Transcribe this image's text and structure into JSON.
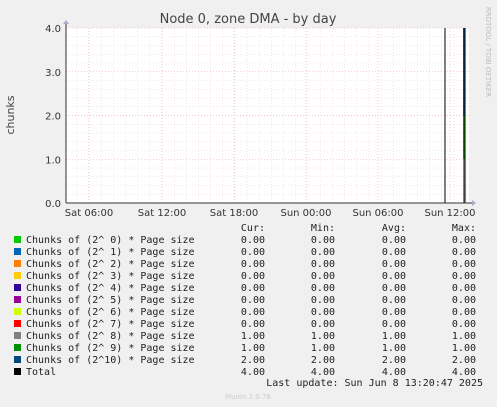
{
  "chart_data": {
    "type": "line",
    "title": "Node 0, zone DMA - by day",
    "ylabel": "chunks",
    "side_label": "RRDTOOL / TOBI OETIKER",
    "ylim": [
      0,
      4
    ],
    "y_ticks": [
      "0.0",
      "1.0",
      "2.0",
      "3.0",
      "4.0"
    ],
    "x_ticks": [
      "Sat 06:00",
      "Sat 12:00",
      "Sat 18:00",
      "Sun 00:00",
      "Sun 06:00",
      "Sun 12:00"
    ],
    "grid": true,
    "columns": [
      "Cur:",
      "Min:",
      "Avg:",
      "Max:"
    ],
    "legend": [
      {
        "name": "Chunks of (2^ 0) * Page size",
        "color": "#00cc00",
        "cur": "0.00",
        "min": "0.00",
        "avg": "0.00",
        "max": "0.00"
      },
      {
        "name": "Chunks of (2^ 1) * Page size",
        "color": "#0066b3",
        "cur": "0.00",
        "min": "0.00",
        "avg": "0.00",
        "max": "0.00"
      },
      {
        "name": "Chunks of (2^ 2) * Page size",
        "color": "#ff8000",
        "cur": "0.00",
        "min": "0.00",
        "avg": "0.00",
        "max": "0.00"
      },
      {
        "name": "Chunks of (2^ 3) * Page size",
        "color": "#ffcc00",
        "cur": "0.00",
        "min": "0.00",
        "avg": "0.00",
        "max": "0.00"
      },
      {
        "name": "Chunks of (2^ 4) * Page size",
        "color": "#330099",
        "cur": "0.00",
        "min": "0.00",
        "avg": "0.00",
        "max": "0.00"
      },
      {
        "name": "Chunks of (2^ 5) * Page size",
        "color": "#990099",
        "cur": "0.00",
        "min": "0.00",
        "avg": "0.00",
        "max": "0.00"
      },
      {
        "name": "Chunks of (2^ 6) * Page size",
        "color": "#ccff00",
        "cur": "0.00",
        "min": "0.00",
        "avg": "0.00",
        "max": "0.00"
      },
      {
        "name": "Chunks of (2^ 7) * Page size",
        "color": "#ff0000",
        "cur": "0.00",
        "min": "0.00",
        "avg": "0.00",
        "max": "0.00"
      },
      {
        "name": "Chunks of (2^ 8) * Page size",
        "color": "#808080",
        "cur": "1.00",
        "min": "1.00",
        "avg": "1.00",
        "max": "1.00"
      },
      {
        "name": "Chunks of (2^ 9) * Page size",
        "color": "#008f00",
        "cur": "1.00",
        "min": "1.00",
        "avg": "1.00",
        "max": "1.00"
      },
      {
        "name": "Chunks of (2^10) * Page size",
        "color": "#00487d",
        "cur": "2.00",
        "min": "2.00",
        "avg": "2.00",
        "max": "2.00"
      },
      {
        "name": "Total",
        "color": "#000000",
        "cur": "4.00",
        "min": "4.00",
        "avg": "4.00",
        "max": "4.00"
      }
    ],
    "last_update": "Last update: Sun Jun  8 13:20:47 2025",
    "footer": "Munin 2.0.76"
  }
}
